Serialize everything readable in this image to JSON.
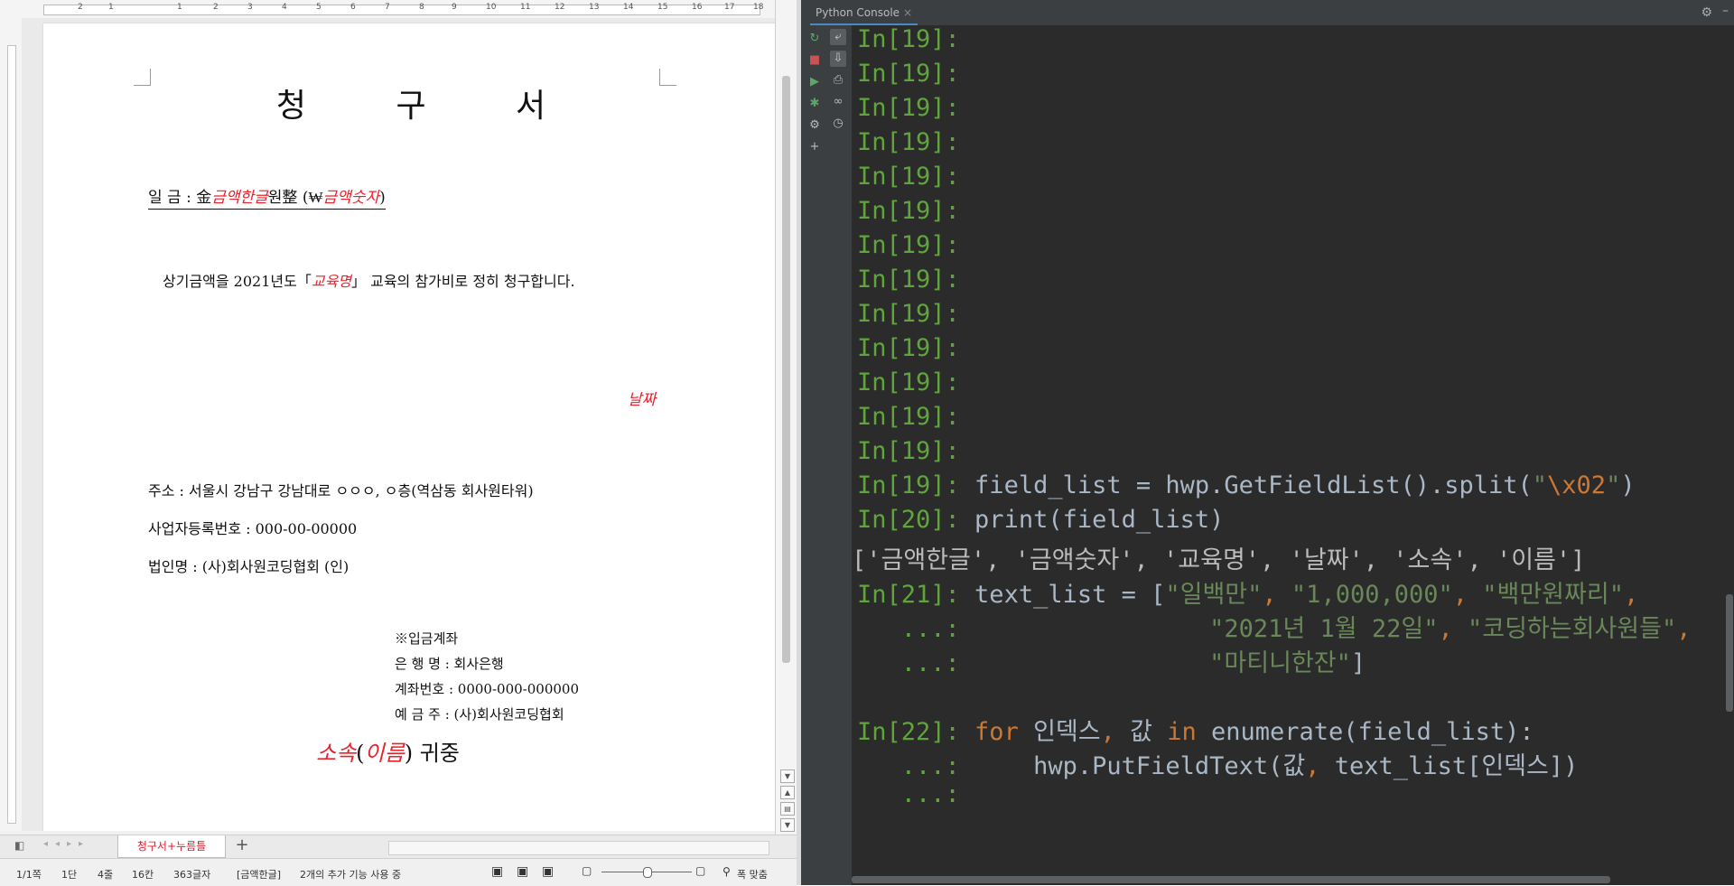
{
  "ruler": {
    "numbers": [
      "2",
      "1",
      "1",
      "2",
      "3",
      "4",
      "5",
      "6",
      "7",
      "8",
      "9",
      "10",
      "11",
      "12",
      "13",
      "14",
      "15",
      "16",
      "17",
      "18"
    ]
  },
  "document": {
    "title": "청 구 서",
    "amount_prefix": "일 금 :  金",
    "amount_hangul_field": "금액한글",
    "amount_mid": "원整 (₩",
    "amount_number_field": "금액숫자",
    "amount_suffix": ")",
    "body_prefix": "상기금액을 2021년도「",
    "body_field": "교육명",
    "body_suffix": "」 교육의 참가비로 정히 청구합니다.",
    "date_field": "날짜",
    "address": "주소 : 서울시 강남구 강남대로 ㅇㅇㅇ, ㅇ층(역삼동 회사원타워)",
    "biz_number": "사업자등록번호 : 000-00-00000",
    "corp_name": "법인명 : (사)회사원코딩협회      (인)",
    "bank_title": "※입금계좌",
    "bank_name": "은 행 명 : 회사은행",
    "account_no": "계좌번호 : 0000-000-000000",
    "holder": "예 금 주 : (사)회사원코딩협회",
    "sign_field_1": "소속",
    "sign_paren_open": "(",
    "sign_field_2": "이름",
    "sign_suffix": ") 귀중"
  },
  "sheet_tab": "청구서+누름틀",
  "status": {
    "page": "1/1쪽",
    "section": "1단",
    "line": "4줄",
    "col": "16칸",
    "chars": "363글자",
    "field": "[금액한글]",
    "features": "2개의 추가 기능 사용 중",
    "zoom": "폭 맞춤"
  },
  "console": {
    "tab": "Python Console",
    "close": "×",
    "empty_prompts": [
      "In[19]:",
      "In[19]:",
      "In[19]:",
      "In[19]:",
      "In[19]:",
      "In[19]:",
      "In[19]:",
      "In[19]:",
      "In[19]:",
      "In[19]:",
      "In[19]:",
      "In[19]:",
      "In[19]:"
    ],
    "l19_prompt": "In[19]:",
    "l19_a": " field_list = hwp.GetFieldList().split(",
    "l19_q1": "\"",
    "l19_esc": "\\x02",
    "l19_q2": "\"",
    "l19_b": ")",
    "l20_prompt": "In[20]:",
    "l20_code": " print(field_list)",
    "output": "['금액한글', '금액숫자', '교육명', '날짜', '소속', '이름']",
    "l21_prompt": "In[21]:",
    "l21_a": " text_list = [",
    "l21_s1": "\"일백만\"",
    "l21_c1": ", ",
    "l21_s2": "\"1,000,000\"",
    "l21_c2": ", ",
    "l21_s3": "\"백만원짜리\"",
    "l21_c3": ",",
    "cont_prompt": "   ...:",
    "l21b_pad": "                 ",
    "l21b_s1": "\"2021년 1월 22일\"",
    "l21b_c1": ", ",
    "l21b_s2": "\"코딩하는회사원들\"",
    "l21b_c2": ",",
    "l21c_s1": "\"마티니한잔\"",
    "l21c_end": "]",
    "l22_prompt": "In[22]:",
    "l22_kw1": " for",
    "l22_a": " 인덱스",
    "l22_comma": ",",
    "l22_b": " 값 ",
    "l22_kw2": "in",
    "l22_c": " enumerate(field_list):",
    "l22b_a": "     hwp.PutFieldText(값",
    "l22b_comma": ",",
    "l22b_b": " text_list[인덱스])"
  }
}
